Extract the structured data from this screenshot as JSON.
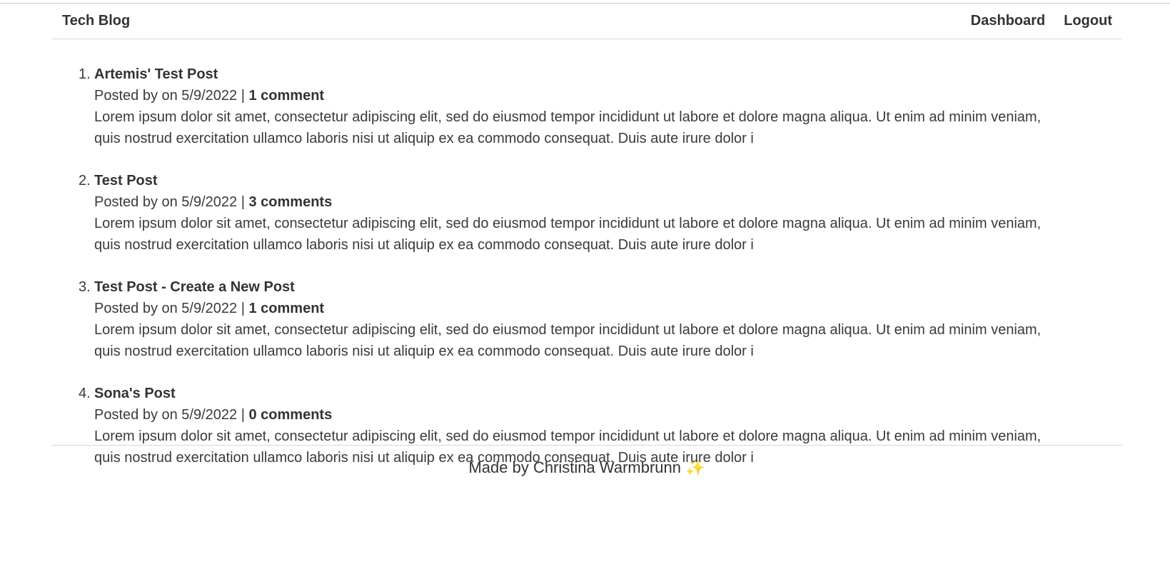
{
  "header": {
    "brand": "Tech Blog",
    "links": [
      "Dashboard",
      "Logout"
    ]
  },
  "posts": [
    {
      "number": "1.",
      "title": "Artemis' Test Post",
      "meta_prefix": "Posted by on 5/9/2022 |",
      "comments": "1 comment",
      "body": "Lorem ipsum dolor sit amet, consectetur adipiscing elit, sed do eiusmod tempor incididunt ut labore et dolore magna aliqua. Ut enim ad minim veniam, quis nostrud exercitation ullamco laboris nisi ut aliquip ex ea commodo consequat. Duis aute irure dolor i"
    },
    {
      "number": "2.",
      "title": "Test Post",
      "meta_prefix": "Posted by on 5/9/2022 |",
      "comments": "3 comments",
      "body": "Lorem ipsum dolor sit amet, consectetur adipiscing elit, sed do eiusmod tempor incididunt ut labore et dolore magna aliqua. Ut enim ad minim veniam, quis nostrud exercitation ullamco laboris nisi ut aliquip ex ea commodo consequat. Duis aute irure dolor i"
    },
    {
      "number": "3.",
      "title": "Test Post - Create a New Post",
      "meta_prefix": "Posted by on 5/9/2022 |",
      "comments": "1 comment",
      "body": "Lorem ipsum dolor sit amet, consectetur adipiscing elit, sed do eiusmod tempor incididunt ut labore et dolore magna aliqua. Ut enim ad minim veniam, quis nostrud exercitation ullamco laboris nisi ut aliquip ex ea commodo consequat. Duis aute irure dolor i"
    },
    {
      "number": "4.",
      "title": "Sona's Post",
      "meta_prefix": "Posted by on 5/9/2022 |",
      "comments": "0 comments",
      "body": "Lorem ipsum dolor sit amet, consectetur adipiscing elit, sed do eiusmod tempor incididunt ut labore et dolore magna aliqua. Ut enim ad minim veniam, quis nostrud exercitation ullamco laboris nisi ut aliquip ex ea commodo consequat. Duis aute irure dolor i"
    }
  ],
  "footer": {
    "text": "Made by Christina Warmbrunn",
    "sparkle": "✨"
  },
  "colors": {
    "text": "#333333",
    "divider": "#d6d6d6",
    "sparkle": "#f2b62b"
  }
}
